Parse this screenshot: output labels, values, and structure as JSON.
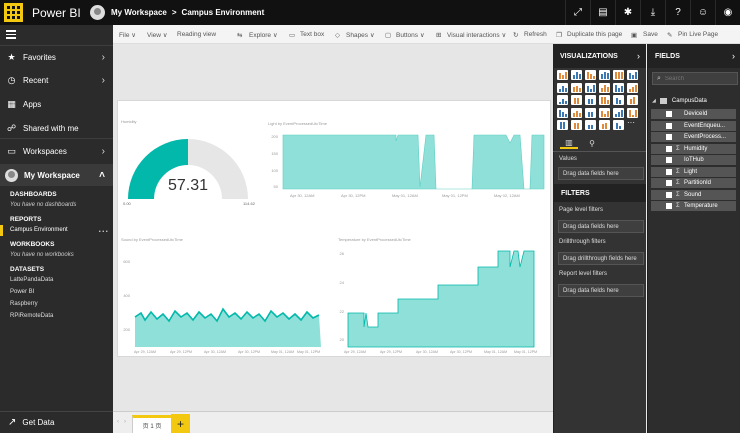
{
  "topbar": {
    "brand": "Power BI",
    "breadcrumb_workspace": "My Workspace",
    "breadcrumb_sep": ">",
    "breadcrumb_report": "Campus Environment",
    "icons": [
      "expand-icon",
      "comment-icon",
      "gear-icon",
      "download-icon",
      "help-icon",
      "smiley-icon",
      "avatar-icon"
    ]
  },
  "nav": {
    "favorites": "Favorites",
    "recent": "Recent",
    "apps": "Apps",
    "shared": "Shared with me",
    "workspaces": "Workspaces",
    "my_workspace": "My Workspace",
    "dashboards_h": "DASHBOARDS",
    "dashboards_empty": "You have no dashboards",
    "reports_h": "REPORTS",
    "report_item": "Campus Environment",
    "report_more": "...",
    "workbooks_h": "WORKBOOKS",
    "workbooks_empty": "You have no workbooks",
    "datasets_h": "DATASETS",
    "datasets": [
      "LattePandaData",
      "Power BI",
      "Raspberry",
      "RPiRemoteData"
    ],
    "get_data": "Get Data"
  },
  "toolbar": {
    "file": "File ∨",
    "view": "View ∨",
    "reading_view": "Reading view",
    "explore": "Explore ∨",
    "text_box": "Text box",
    "shapes": "Shapes ∨",
    "buttons": "Buttons ∨",
    "visual_interactions": "Visual interactions ∨",
    "refresh": "Refresh",
    "duplicate": "Duplicate this page",
    "save": "Save",
    "pin": "Pin Live Page"
  },
  "gauge": {
    "title": "Humidity",
    "value_text": "57.31",
    "min_label": "0.00",
    "max_label": "114.62",
    "fraction": 0.5
  },
  "light_chart": {
    "title": "Light by EventProcessedUtcTime",
    "x_ticks": [
      "Apr 30, 12AM",
      "Apr 30, 12PM",
      "May 01, 12AM",
      "May 01, 12PM",
      "May 02, 12AM"
    ],
    "y_ticks": [
      "200",
      "150",
      "100",
      "50"
    ]
  },
  "sound_chart": {
    "title": "Sound by EventProcessedUtcTime",
    "x_ticks": [
      "Apr 29, 12AM",
      "Apr 29, 12PM",
      "Apr 30, 12AM",
      "Apr 30, 12PM",
      "May 01, 12AM",
      "May 01, 12PM"
    ],
    "y_ticks": [
      "600",
      "400",
      "200"
    ]
  },
  "temp_chart": {
    "title": "Temperature by EventProcessedUtcTime",
    "x_ticks": [
      "Apr 29, 12AM",
      "Apr 29, 12PM",
      "Apr 30, 12AM",
      "Apr 30, 12PM",
      "May 01, 12AM",
      "May 01, 12PM"
    ],
    "y_ticks": [
      "26",
      "24",
      "22",
      "20"
    ]
  },
  "pagebar": {
    "page_label": "页 1 页",
    "add": "+"
  },
  "visualizations": {
    "title": "VISUALIZATIONS",
    "values_label": "Values",
    "values_drop": "Drag data fields here",
    "filters_title": "FILTERS",
    "page_filters": "Page level filters",
    "page_drop": "Drag data fields here",
    "drill_filters": "Drillthrough filters",
    "drill_drop": "Drag drillthrough fields here",
    "report_filters": "Report level filters",
    "report_drop": "Drag data fields here"
  },
  "fields": {
    "title": "FIELDS",
    "search_placeholder": "Search",
    "table": "CampusData",
    "items": [
      {
        "name": "DeviceId",
        "sigma": ""
      },
      {
        "name": "EventEnqueu...",
        "sigma": ""
      },
      {
        "name": "EventProcess...",
        "sigma": ""
      },
      {
        "name": "Humidity",
        "sigma": "Σ"
      },
      {
        "name": "IoTHub",
        "sigma": ""
      },
      {
        "name": "Light",
        "sigma": "Σ"
      },
      {
        "name": "PartitionId",
        "sigma": "Σ"
      },
      {
        "name": "Sound",
        "sigma": "Σ"
      },
      {
        "name": "Temperature",
        "sigma": "Σ"
      }
    ]
  },
  "colors": {
    "accent": "#f2c811",
    "teal": "#01b8aa",
    "teal_light": "#8fe0d8"
  }
}
